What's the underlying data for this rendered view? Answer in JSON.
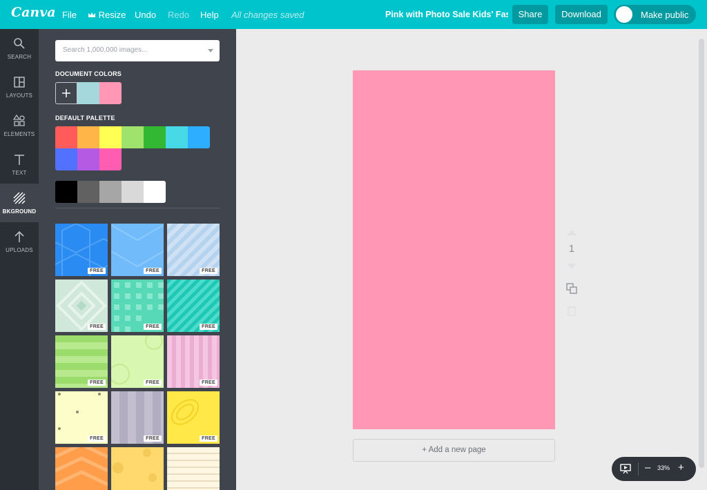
{
  "topbar": {
    "logo": "Canva",
    "menu": {
      "file": "File",
      "resize": "Resize",
      "undo": "Undo",
      "redo": "Redo",
      "help": "Help"
    },
    "saved_status": "All changes saved",
    "document_title": "Pink with Photo Sale Kids' Fas...",
    "share": "Share",
    "download": "Download",
    "make_public": "Make public",
    "bar_color": "#00c4cc"
  },
  "rail": {
    "items": [
      {
        "label": "SEARCH",
        "icon": "search-icon"
      },
      {
        "label": "LAYOUTS",
        "icon": "layouts-icon"
      },
      {
        "label": "ELEMENTS",
        "icon": "elements-icon"
      },
      {
        "label": "TEXT",
        "icon": "text-icon"
      },
      {
        "label": "BKGROUND",
        "icon": "background-icon",
        "active": true
      },
      {
        "label": "UPLOADS",
        "icon": "upload-icon"
      }
    ]
  },
  "panel": {
    "search_placeholder": "Search 1,000,000 images...",
    "document_colors_label": "DOCUMENT COLORS",
    "document_colors": [
      "#a5d8dd",
      "#ff97b5"
    ],
    "default_palette_label": "DEFAULT PALETTE",
    "palette_row1": [
      "#ff5b5b",
      "#ffb548",
      "#ffff54",
      "#9fe36c",
      "#33b834",
      "#48d9e6",
      "#2daefe"
    ],
    "palette_row2": [
      "#5271ff",
      "#b45ae3",
      "#ff5db2"
    ],
    "grays": [
      "#000000",
      "#616161",
      "#a6a6a6",
      "#d9d9d9",
      "#ffffff"
    ],
    "free_badge": "FREE"
  },
  "canvas": {
    "page_color": "#ff97b5",
    "add_page": "+ Add a new page",
    "page_number": "1"
  },
  "zoom": {
    "level": "33%",
    "minus": "–",
    "plus": "+"
  }
}
